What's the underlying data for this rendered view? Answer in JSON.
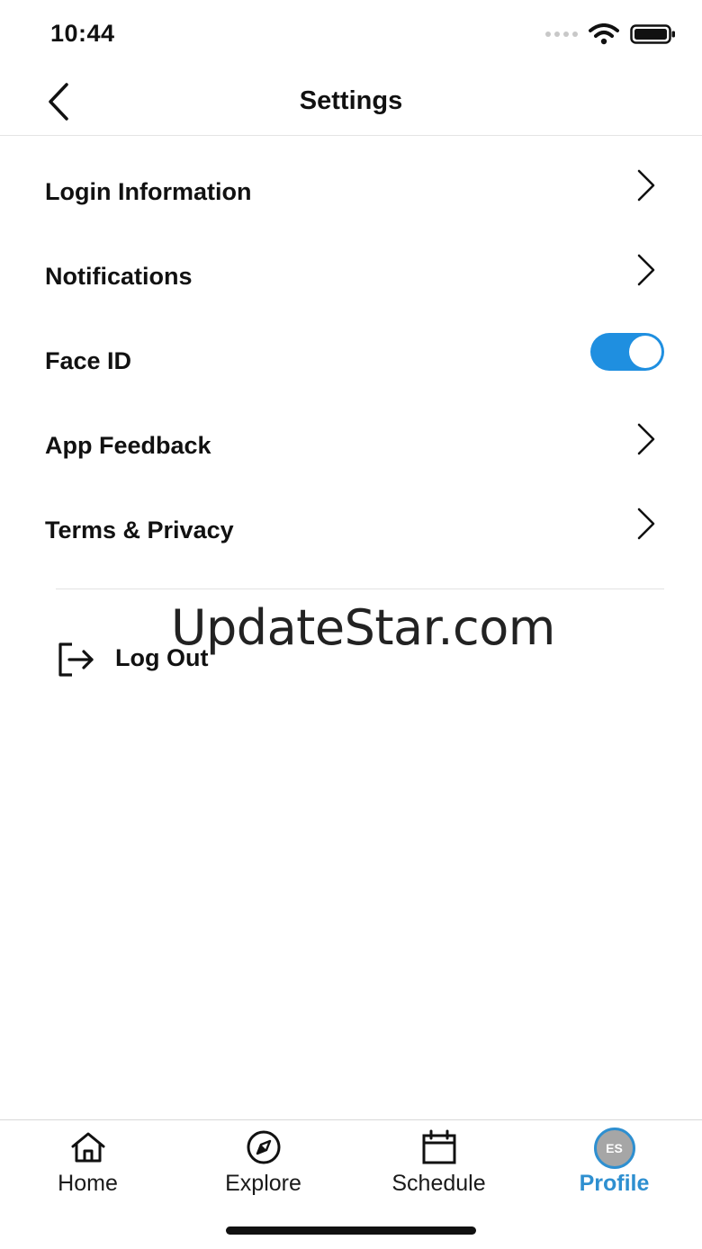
{
  "status_bar": {
    "time": "10:44"
  },
  "header": {
    "title": "Settings"
  },
  "settings": {
    "items": [
      {
        "label": "Login Information"
      },
      {
        "label": "Notifications"
      },
      {
        "label": "Face ID",
        "toggle_on": true
      },
      {
        "label": "App Feedback"
      },
      {
        "label": "Terms & Privacy"
      }
    ],
    "logout_label": "Log Out"
  },
  "watermark": "UpdateStar.com",
  "tab_bar": {
    "tabs": [
      {
        "label": "Home",
        "icon": "home-icon"
      },
      {
        "label": "Explore",
        "icon": "compass-icon"
      },
      {
        "label": "Schedule",
        "icon": "calendar-icon"
      },
      {
        "label": "Profile",
        "icon": "avatar",
        "avatar_initials": "ES",
        "active": true
      }
    ]
  },
  "colors": {
    "accent": "#2e8fd0",
    "toggle_on": "#1f8fe0",
    "text": "#111111"
  }
}
